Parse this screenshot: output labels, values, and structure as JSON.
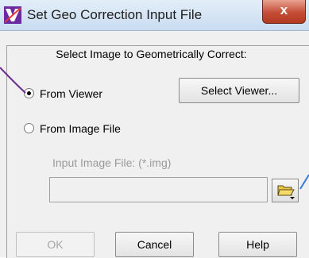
{
  "window": {
    "title": "Set Geo Correction Input File",
    "close_label": "x"
  },
  "heading": "Select Image to Geometrically Correct:",
  "source": {
    "from_viewer_label": "From Viewer",
    "from_viewer_selected": true,
    "from_image_file_label": "From Image File",
    "from_image_file_selected": false,
    "select_viewer_label": "Select Viewer..."
  },
  "input_file": {
    "label": "Input Image File: (*.img)",
    "value": ""
  },
  "buttons": {
    "ok": "OK",
    "cancel": "Cancel",
    "help": "Help"
  },
  "colors": {
    "annotation_line": "#6b2f8e",
    "annotation_line_right": "#3a7bd5"
  }
}
